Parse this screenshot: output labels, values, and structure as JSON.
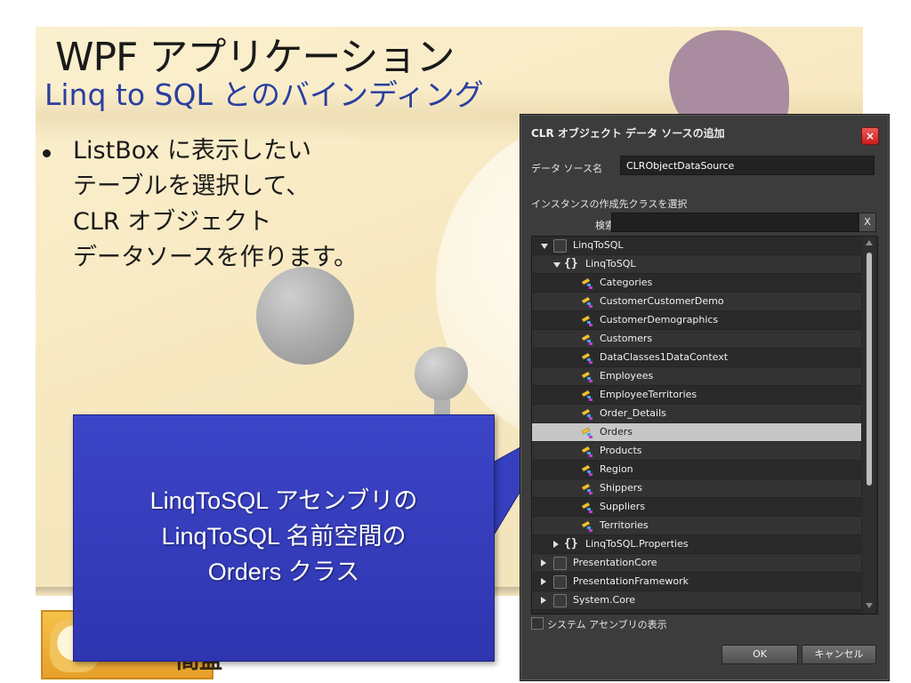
{
  "slide": {
    "title": "WPF アプリケーション",
    "subtitle": "Linq to SQL とのバインディング",
    "bullet_lines": [
      "ListBox に表示したい",
      "テーブルを選択して、",
      "CLR オブジェクト",
      "データソースを作ります。"
    ],
    "callout_lines": [
      "LinqToSQL アセンブリの",
      "LinqToSQL 名前空間の",
      "Orders クラス"
    ],
    "badge_label": "間盖",
    "colors": {
      "callout": "#3c45c8",
      "subtitle": "#2a3fa0",
      "background": "#fbf0cf",
      "dialog": "#3c3c3c",
      "close_button": "#d22b2b"
    }
  },
  "dialog": {
    "title": "CLR オブジェクト データ ソースの追加",
    "close_label": "×",
    "data_source_name_label": "データ ソース名",
    "data_source_name_value": "CLRObjectDataSource",
    "select_class_label": "インスタンスの作成先クラスを選択",
    "search_label": "検索",
    "search_value": "",
    "search_clear_label": "X",
    "tree": [
      {
        "label": "LinqToSQL",
        "kind": "assembly",
        "expand": "down"
      },
      {
        "label": "LinqToSQL",
        "kind": "namespace",
        "expand": "down"
      },
      {
        "label": "Categories",
        "kind": "class"
      },
      {
        "label": "CustomerCustomerDemo",
        "kind": "class"
      },
      {
        "label": "CustomerDemographics",
        "kind": "class"
      },
      {
        "label": "Customers",
        "kind": "class"
      },
      {
        "label": "DataClasses1DataContext",
        "kind": "class"
      },
      {
        "label": "Employees",
        "kind": "class"
      },
      {
        "label": "EmployeeTerritories",
        "kind": "class"
      },
      {
        "label": "Order_Details",
        "kind": "class"
      },
      {
        "label": "Orders",
        "kind": "class",
        "selected": true
      },
      {
        "label": "Products",
        "kind": "class"
      },
      {
        "label": "Region",
        "kind": "class"
      },
      {
        "label": "Shippers",
        "kind": "class"
      },
      {
        "label": "Suppliers",
        "kind": "class"
      },
      {
        "label": "Territories",
        "kind": "class"
      },
      {
        "label": "LinqToSQL.Properties",
        "kind": "namespace",
        "expand": "right"
      },
      {
        "label": "PresentationCore",
        "kind": "assembly",
        "expand": "right"
      },
      {
        "label": "PresentationFramework",
        "kind": "assembly",
        "expand": "right"
      },
      {
        "label": "System.Core",
        "kind": "assembly",
        "expand": "right"
      }
    ],
    "show_system_assemblies_label": "システム アセンブリの表示",
    "show_system_assemblies_checked": false,
    "ok_label": "OK",
    "cancel_label": "キャンセル"
  }
}
